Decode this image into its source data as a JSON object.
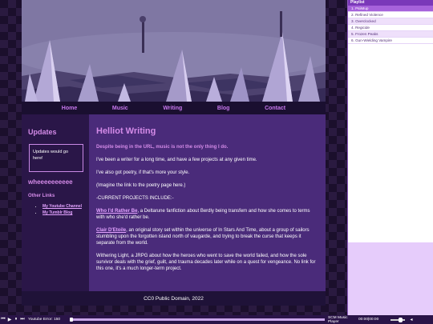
{
  "nav": {
    "items": [
      "Home",
      "Music",
      "Writing",
      "Blog",
      "Contact"
    ]
  },
  "sidebar": {
    "updates_title": "Updates",
    "updates_box": "Updates would go here!",
    "big_text": "wheeeeeeeeee",
    "links_title": "Other Links",
    "links": [
      "My Youtube Channel",
      "My Tumblr Blog"
    ]
  },
  "main": {
    "title": "Helliot Writing",
    "lead": "Despite being in the URL, music is not the only thing I do.",
    "p1": "I've been a writer for a long time, and have a few projects at any given time.",
    "p2": "I've also got poetry, if that's more your style.",
    "p3": "(Imagine the link to the poetry page here.)",
    "p4": "-CURRENT PROJECTS INCLUDE:-",
    "project1_link": "Who I'd Rather Be",
    "project1_text": ", a Deltarune fanfiction about Berdly being transfem and how she comes to terms with who she'd rather be.",
    "project2_link": "Clair D'Etoile",
    "project2_text": ", an original story set within the universe of In Stars And Time, about a group of sailors stumbling upon the forgotten island north of vaugarde, and trying to break the curse that keeps it separate from the world.",
    "project3_text": "Withering Light, a JRPG about how the heroes who went to save the world failed, and how the sole survivor deals with the grief, guilt, and trauma decades later while on a quest for vengeance. No link for this one, it's a much longer-term project."
  },
  "footer": "CC0 Public Domain, 2022",
  "playlist": {
    "title": "Playlist",
    "items": [
      "1. PsiiMup",
      "2. Refined Violence",
      "3. Overclocked",
      "4. Regicide",
      "5. Frozen Peaks",
      "6. Gun-Wielding Vampire"
    ],
    "active_index": 0
  },
  "player": {
    "track_label": "Youtube Error: 150",
    "app_name": "SCM Music Player",
    "time": "00:00|00:00",
    "progress": 0,
    "volume": 0.65,
    "icons": [
      "prev-icon",
      "play-icon",
      "pause-icon",
      "next-icon",
      "volume-icon"
    ]
  },
  "colors": {
    "accent": "#d48be8",
    "main_bg": "#4a2b7a",
    "side_bg": "#2a1648",
    "playlist_active": "#a662db"
  }
}
